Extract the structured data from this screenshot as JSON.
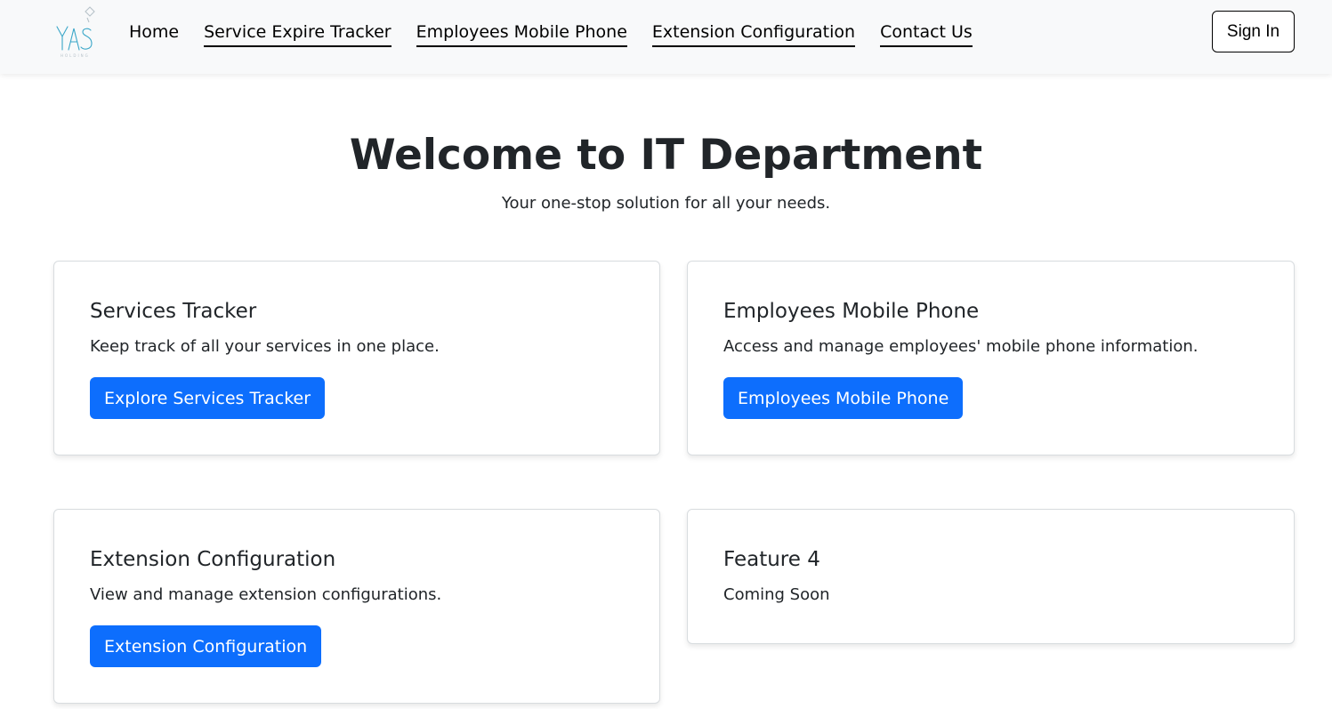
{
  "navbar": {
    "links": [
      {
        "label": "Home",
        "underlined": false
      },
      {
        "label": "Service Expire Tracker",
        "underlined": true
      },
      {
        "label": "Employees Mobile Phone",
        "underlined": true
      },
      {
        "label": "Extension Configuration",
        "underlined": true
      },
      {
        "label": "Contact Us",
        "underlined": true
      }
    ],
    "signin_label": "Sign In"
  },
  "hero": {
    "title": "Welcome to IT Department",
    "subtitle": "Your one-stop solution for all your needs."
  },
  "cards": [
    {
      "title": "Services Tracker",
      "text": "Keep track of all your services in one place.",
      "button": "Explore Services Tracker"
    },
    {
      "title": "Employees Mobile Phone",
      "text": "Access and manage employees' mobile phone information.",
      "button": "Employees Mobile Phone"
    },
    {
      "title": "Extension Configuration",
      "text": "View and manage extension configurations.",
      "button": "Extension Configuration"
    },
    {
      "title": "Feature 4",
      "text": "Coming Soon"
    }
  ],
  "colors": {
    "primary": "#0d6efd",
    "navbar_bg": "#f8f9fa",
    "logo": "#3aa6c8",
    "text": "#212529"
  }
}
